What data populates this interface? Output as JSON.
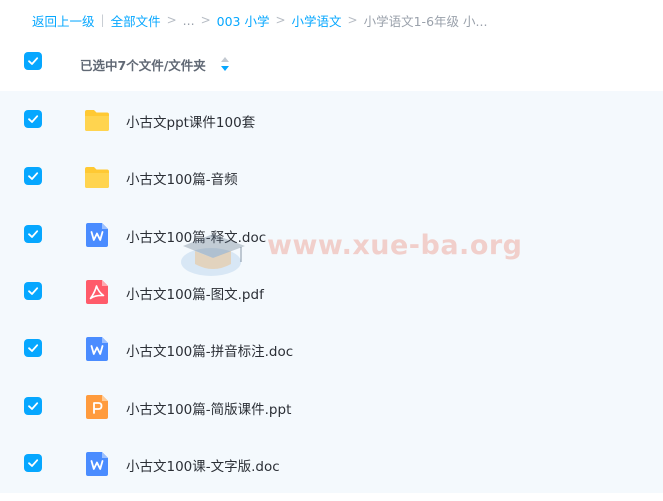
{
  "breadcrumb": {
    "back": "返回上一级",
    "all_files": "全部文件",
    "ellipsis": "...",
    "folder1": "003 小学",
    "folder2": "小学语文",
    "current": "小学语文1-6年级 小..."
  },
  "selection": {
    "count_label": "已选中7个文件/文件夹"
  },
  "files": [
    {
      "name": "小古文ppt课件100套",
      "type": "folder",
      "icon": "folder-icon"
    },
    {
      "name": "小古文100篇-音频",
      "type": "folder",
      "icon": "folder-icon"
    },
    {
      "name": "小古文100篇-释文.doc",
      "type": "doc",
      "icon": "word-doc-icon"
    },
    {
      "name": "小古文100篇-图文.pdf",
      "type": "pdf",
      "icon": "pdf-icon"
    },
    {
      "name": "小古文100篇-拼音标注.doc",
      "type": "doc",
      "icon": "word-doc-icon"
    },
    {
      "name": "小古文100篇-简版课件.ppt",
      "type": "ppt",
      "icon": "ppt-icon"
    },
    {
      "name": "小古文100课-文字版.doc",
      "type": "doc",
      "icon": "word-doc-icon"
    }
  ],
  "watermark": {
    "text": "www.xue-ba.org"
  },
  "colors": {
    "accent": "#06a7ff",
    "folder": "#ffc933",
    "doc": "#4a8cff",
    "pdf": "#ff5b6a",
    "ppt": "#ff9b3d",
    "list_bg": "#f4f9fd"
  }
}
